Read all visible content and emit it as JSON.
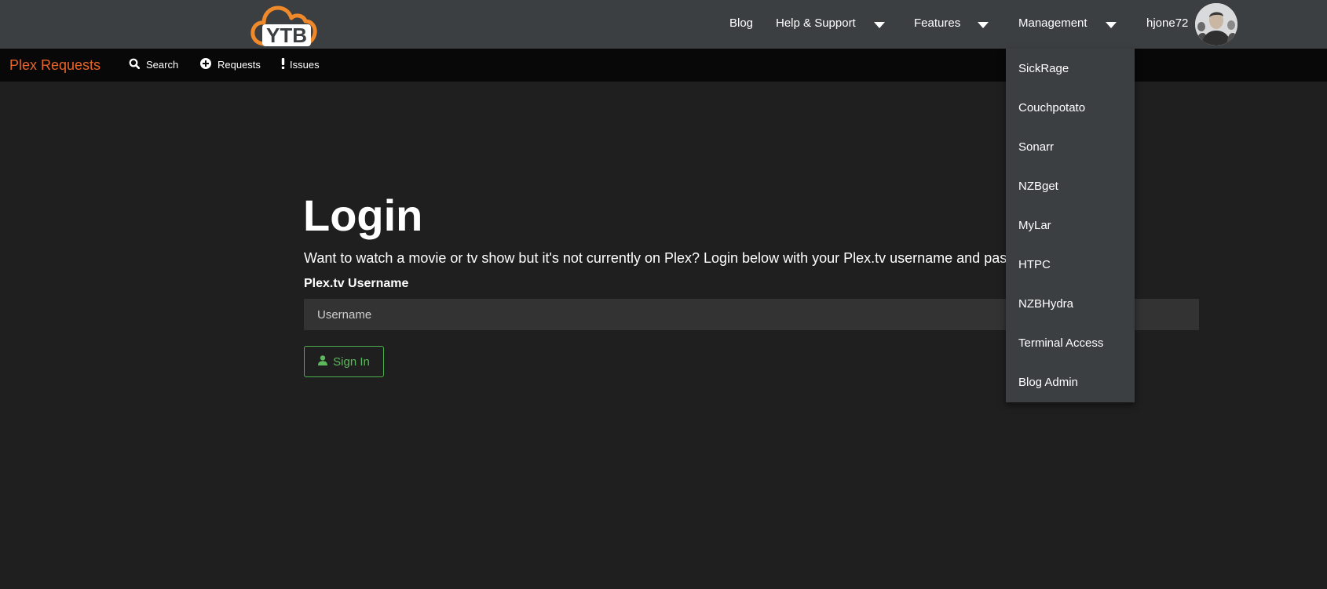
{
  "topnav": {
    "logo_text": "YTB",
    "items": [
      {
        "label": "Blog",
        "has_dropdown": false
      },
      {
        "label": "Help & Support",
        "has_dropdown": true
      },
      {
        "label": "Features",
        "has_dropdown": true
      },
      {
        "label": "Management",
        "has_dropdown": true
      }
    ],
    "username": "hjone72"
  },
  "subnav": {
    "brand": "Plex Requests",
    "items": [
      {
        "label": "Search",
        "icon": "search-icon"
      },
      {
        "label": "Requests",
        "icon": "plus-circle-icon"
      },
      {
        "label": "Issues",
        "icon": "exclamation-icon"
      }
    ]
  },
  "management_dropdown": {
    "items": [
      {
        "label": "SickRage"
      },
      {
        "label": "Couchpotato"
      },
      {
        "label": "Sonarr"
      },
      {
        "label": "NZBget"
      },
      {
        "label": "MyLar"
      },
      {
        "label": "HTPC"
      },
      {
        "label": "NZBHydra"
      },
      {
        "label": "Terminal Access"
      },
      {
        "label": "Blog Admin"
      }
    ]
  },
  "login": {
    "title": "Login",
    "description": "Want to watch a movie or tv show but it's not currently on Plex? Login below with your Plex.tv username and password!",
    "username_label": "Plex.tv Username",
    "username_placeholder": "Username",
    "username_value": "",
    "signin_label": "Sign In",
    "signin_icon": "user-icon"
  },
  "colors": {
    "topbar_bg": "#3c3f42",
    "subbar_bg": "#080808",
    "page_bg": "#1f1f1f",
    "brand_orange": "#e8652a",
    "logo_orange": "#f0892a",
    "button_green": "#5cb85c"
  }
}
